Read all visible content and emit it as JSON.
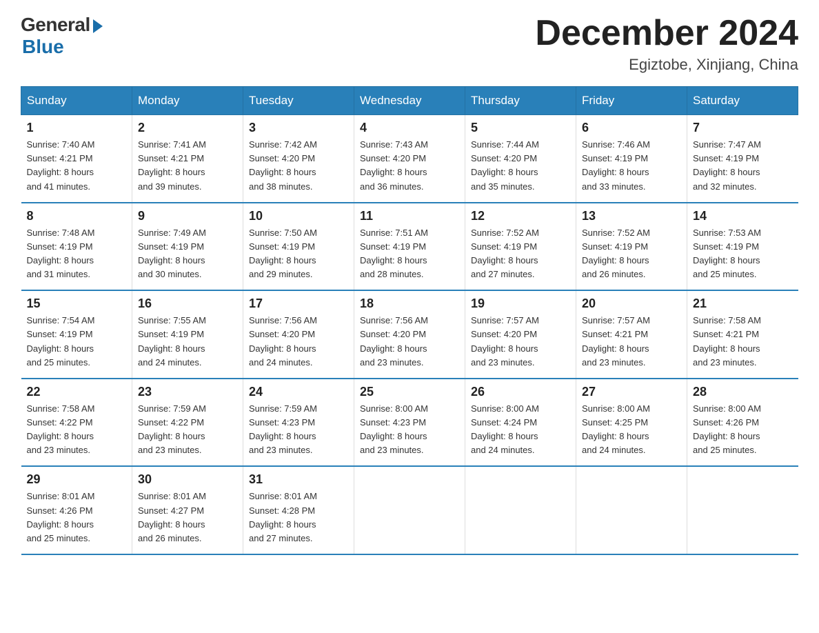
{
  "header": {
    "logo_general": "General",
    "logo_blue": "Blue",
    "month_title": "December 2024",
    "location": "Egiztobe, Xinjiang, China"
  },
  "days_of_week": [
    "Sunday",
    "Monday",
    "Tuesday",
    "Wednesday",
    "Thursday",
    "Friday",
    "Saturday"
  ],
  "weeks": [
    [
      {
        "day": "1",
        "sunrise": "7:40 AM",
        "sunset": "4:21 PM",
        "daylight": "8 hours and 41 minutes."
      },
      {
        "day": "2",
        "sunrise": "7:41 AM",
        "sunset": "4:21 PM",
        "daylight": "8 hours and 39 minutes."
      },
      {
        "day": "3",
        "sunrise": "7:42 AM",
        "sunset": "4:20 PM",
        "daylight": "8 hours and 38 minutes."
      },
      {
        "day": "4",
        "sunrise": "7:43 AM",
        "sunset": "4:20 PM",
        "daylight": "8 hours and 36 minutes."
      },
      {
        "day": "5",
        "sunrise": "7:44 AM",
        "sunset": "4:20 PM",
        "daylight": "8 hours and 35 minutes."
      },
      {
        "day": "6",
        "sunrise": "7:46 AM",
        "sunset": "4:19 PM",
        "daylight": "8 hours and 33 minutes."
      },
      {
        "day": "7",
        "sunrise": "7:47 AM",
        "sunset": "4:19 PM",
        "daylight": "8 hours and 32 minutes."
      }
    ],
    [
      {
        "day": "8",
        "sunrise": "7:48 AM",
        "sunset": "4:19 PM",
        "daylight": "8 hours and 31 minutes."
      },
      {
        "day": "9",
        "sunrise": "7:49 AM",
        "sunset": "4:19 PM",
        "daylight": "8 hours and 30 minutes."
      },
      {
        "day": "10",
        "sunrise": "7:50 AM",
        "sunset": "4:19 PM",
        "daylight": "8 hours and 29 minutes."
      },
      {
        "day": "11",
        "sunrise": "7:51 AM",
        "sunset": "4:19 PM",
        "daylight": "8 hours and 28 minutes."
      },
      {
        "day": "12",
        "sunrise": "7:52 AM",
        "sunset": "4:19 PM",
        "daylight": "8 hours and 27 minutes."
      },
      {
        "day": "13",
        "sunrise": "7:52 AM",
        "sunset": "4:19 PM",
        "daylight": "8 hours and 26 minutes."
      },
      {
        "day": "14",
        "sunrise": "7:53 AM",
        "sunset": "4:19 PM",
        "daylight": "8 hours and 25 minutes."
      }
    ],
    [
      {
        "day": "15",
        "sunrise": "7:54 AM",
        "sunset": "4:19 PM",
        "daylight": "8 hours and 25 minutes."
      },
      {
        "day": "16",
        "sunrise": "7:55 AM",
        "sunset": "4:19 PM",
        "daylight": "8 hours and 24 minutes."
      },
      {
        "day": "17",
        "sunrise": "7:56 AM",
        "sunset": "4:20 PM",
        "daylight": "8 hours and 24 minutes."
      },
      {
        "day": "18",
        "sunrise": "7:56 AM",
        "sunset": "4:20 PM",
        "daylight": "8 hours and 23 minutes."
      },
      {
        "day": "19",
        "sunrise": "7:57 AM",
        "sunset": "4:20 PM",
        "daylight": "8 hours and 23 minutes."
      },
      {
        "day": "20",
        "sunrise": "7:57 AM",
        "sunset": "4:21 PM",
        "daylight": "8 hours and 23 minutes."
      },
      {
        "day": "21",
        "sunrise": "7:58 AM",
        "sunset": "4:21 PM",
        "daylight": "8 hours and 23 minutes."
      }
    ],
    [
      {
        "day": "22",
        "sunrise": "7:58 AM",
        "sunset": "4:22 PM",
        "daylight": "8 hours and 23 minutes."
      },
      {
        "day": "23",
        "sunrise": "7:59 AM",
        "sunset": "4:22 PM",
        "daylight": "8 hours and 23 minutes."
      },
      {
        "day": "24",
        "sunrise": "7:59 AM",
        "sunset": "4:23 PM",
        "daylight": "8 hours and 23 minutes."
      },
      {
        "day": "25",
        "sunrise": "8:00 AM",
        "sunset": "4:23 PM",
        "daylight": "8 hours and 23 minutes."
      },
      {
        "day": "26",
        "sunrise": "8:00 AM",
        "sunset": "4:24 PM",
        "daylight": "8 hours and 24 minutes."
      },
      {
        "day": "27",
        "sunrise": "8:00 AM",
        "sunset": "4:25 PM",
        "daylight": "8 hours and 24 minutes."
      },
      {
        "day": "28",
        "sunrise": "8:00 AM",
        "sunset": "4:26 PM",
        "daylight": "8 hours and 25 minutes."
      }
    ],
    [
      {
        "day": "29",
        "sunrise": "8:01 AM",
        "sunset": "4:26 PM",
        "daylight": "8 hours and 25 minutes."
      },
      {
        "day": "30",
        "sunrise": "8:01 AM",
        "sunset": "4:27 PM",
        "daylight": "8 hours and 26 minutes."
      },
      {
        "day": "31",
        "sunrise": "8:01 AM",
        "sunset": "4:28 PM",
        "daylight": "8 hours and 27 minutes."
      },
      null,
      null,
      null,
      null
    ]
  ],
  "labels": {
    "sunrise": "Sunrise:",
    "sunset": "Sunset:",
    "daylight": "Daylight:"
  }
}
